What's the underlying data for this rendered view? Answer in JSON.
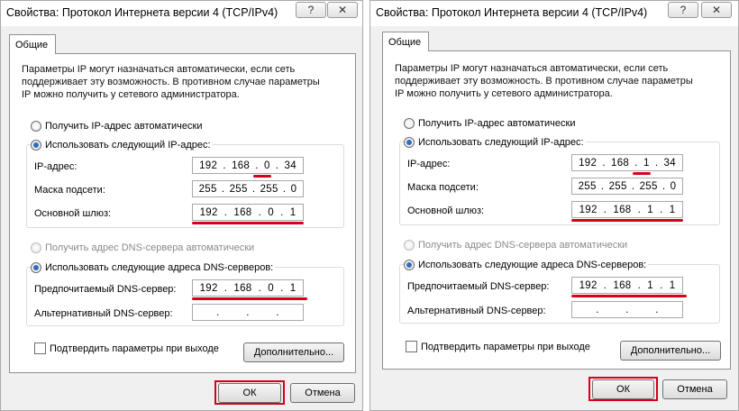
{
  "left": {
    "title": "Свойства: Протокол Интернета версии 4 (TCP/IPv4)",
    "help_label": "?",
    "close_label": "✕",
    "tab_label": "Общие",
    "description": [
      "Параметры IP могут назначаться автоматически, если сеть",
      "поддерживает эту возможность. В противном случае параметры",
      "IP можно получить у сетевого администратора."
    ],
    "radio_auto_ip": "Получить IP-адрес автоматически",
    "radio_manual_ip": "Использовать следующий IP-адрес:",
    "ip_label": "IP-адрес:",
    "ip": [
      "192",
      "168",
      "0",
      "34"
    ],
    "mask_label": "Маска подсети:",
    "mask": [
      "255",
      "255",
      "255",
      "0"
    ],
    "gateway_label": "Основной шлюз:",
    "gateway": [
      "192",
      "168",
      "0",
      "1"
    ],
    "radio_auto_dns": "Получить адрес DNS-сервера автоматически",
    "radio_manual_dns": "Использовать следующие адреса DNS-серверов:",
    "pref_dns_label": "Предпочитаемый DNS-сервер:",
    "pref_dns": [
      "192",
      "168",
      "0",
      "1"
    ],
    "alt_dns_label": "Альтернативный DNS-сервер:",
    "alt_dns": [
      "",
      "",
      "",
      ""
    ],
    "confirm_label": "Подтвердить параметры при выходе",
    "advanced_label": "Дополнительно...",
    "ok_label": "ОК",
    "cancel_label": "Отмена"
  },
  "right": {
    "title": "Свойства: Протокол Интернета версии 4 (TCP/IPv4)",
    "help_label": "?",
    "close_label": "✕",
    "tab_label": "Общие",
    "description": [
      "Параметры IP могут назначаться автоматически, если сеть",
      "поддерживает эту возможность. В противном случае параметры",
      "IP можно получить у сетевого администратора."
    ],
    "radio_auto_ip": "Получить IP-адрес автоматически",
    "radio_manual_ip": "Использовать следующий IP-адрес:",
    "ip_label": "IP-адрес:",
    "ip": [
      "192",
      "168",
      "1",
      "34"
    ],
    "mask_label": "Маска подсети:",
    "mask": [
      "255",
      "255",
      "255",
      "0"
    ],
    "gateway_label": "Основной шлюз:",
    "gateway": [
      "192",
      "168",
      "1",
      "1"
    ],
    "radio_auto_dns": "Получить адрес DNS-сервера автоматически",
    "radio_manual_dns": "Использовать следующие адреса DNS-серверов:",
    "pref_dns_label": "Предпочитаемый DNS-сервер:",
    "pref_dns": [
      "192",
      "168",
      "1",
      "1"
    ],
    "alt_dns_label": "Альтернативный DNS-сервер:",
    "alt_dns": [
      "",
      "",
      "",
      ""
    ],
    "confirm_label": "Подтвердить параметры при выходе",
    "advanced_label": "Дополнительно...",
    "ok_label": "ОК",
    "cancel_label": "Отмена"
  },
  "colors": {
    "highlight": "#d5001c",
    "radio_selected": "#2f6bbf"
  }
}
